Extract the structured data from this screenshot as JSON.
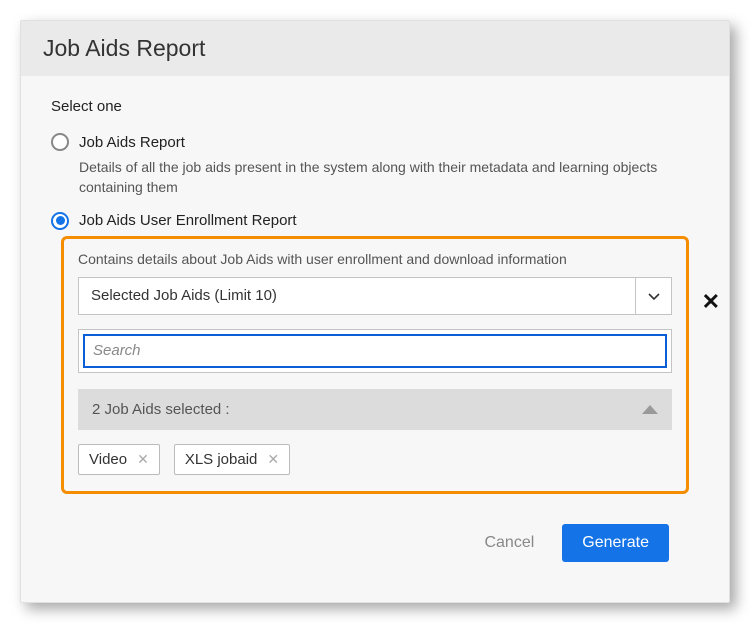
{
  "header": {
    "title": "Job Aids Report"
  },
  "subheading": "Select one",
  "options": [
    {
      "label": "Job Aids Report",
      "description": "Details of all the job aids present in the system along with their metadata and learning objects containing them",
      "selected": false
    },
    {
      "label": "Job Aids User Enrollment Report",
      "description": "Contains details about Job Aids with user enrollment and download information",
      "selected": true
    }
  ],
  "panel": {
    "select_label": "Selected Job Aids (Limit 10)",
    "search_placeholder": "Search",
    "selected_count_label": "2 Job Aids selected :",
    "chips": [
      "Video",
      "XLS jobaid"
    ]
  },
  "footer": {
    "cancel": "Cancel",
    "generate": "Generate"
  }
}
